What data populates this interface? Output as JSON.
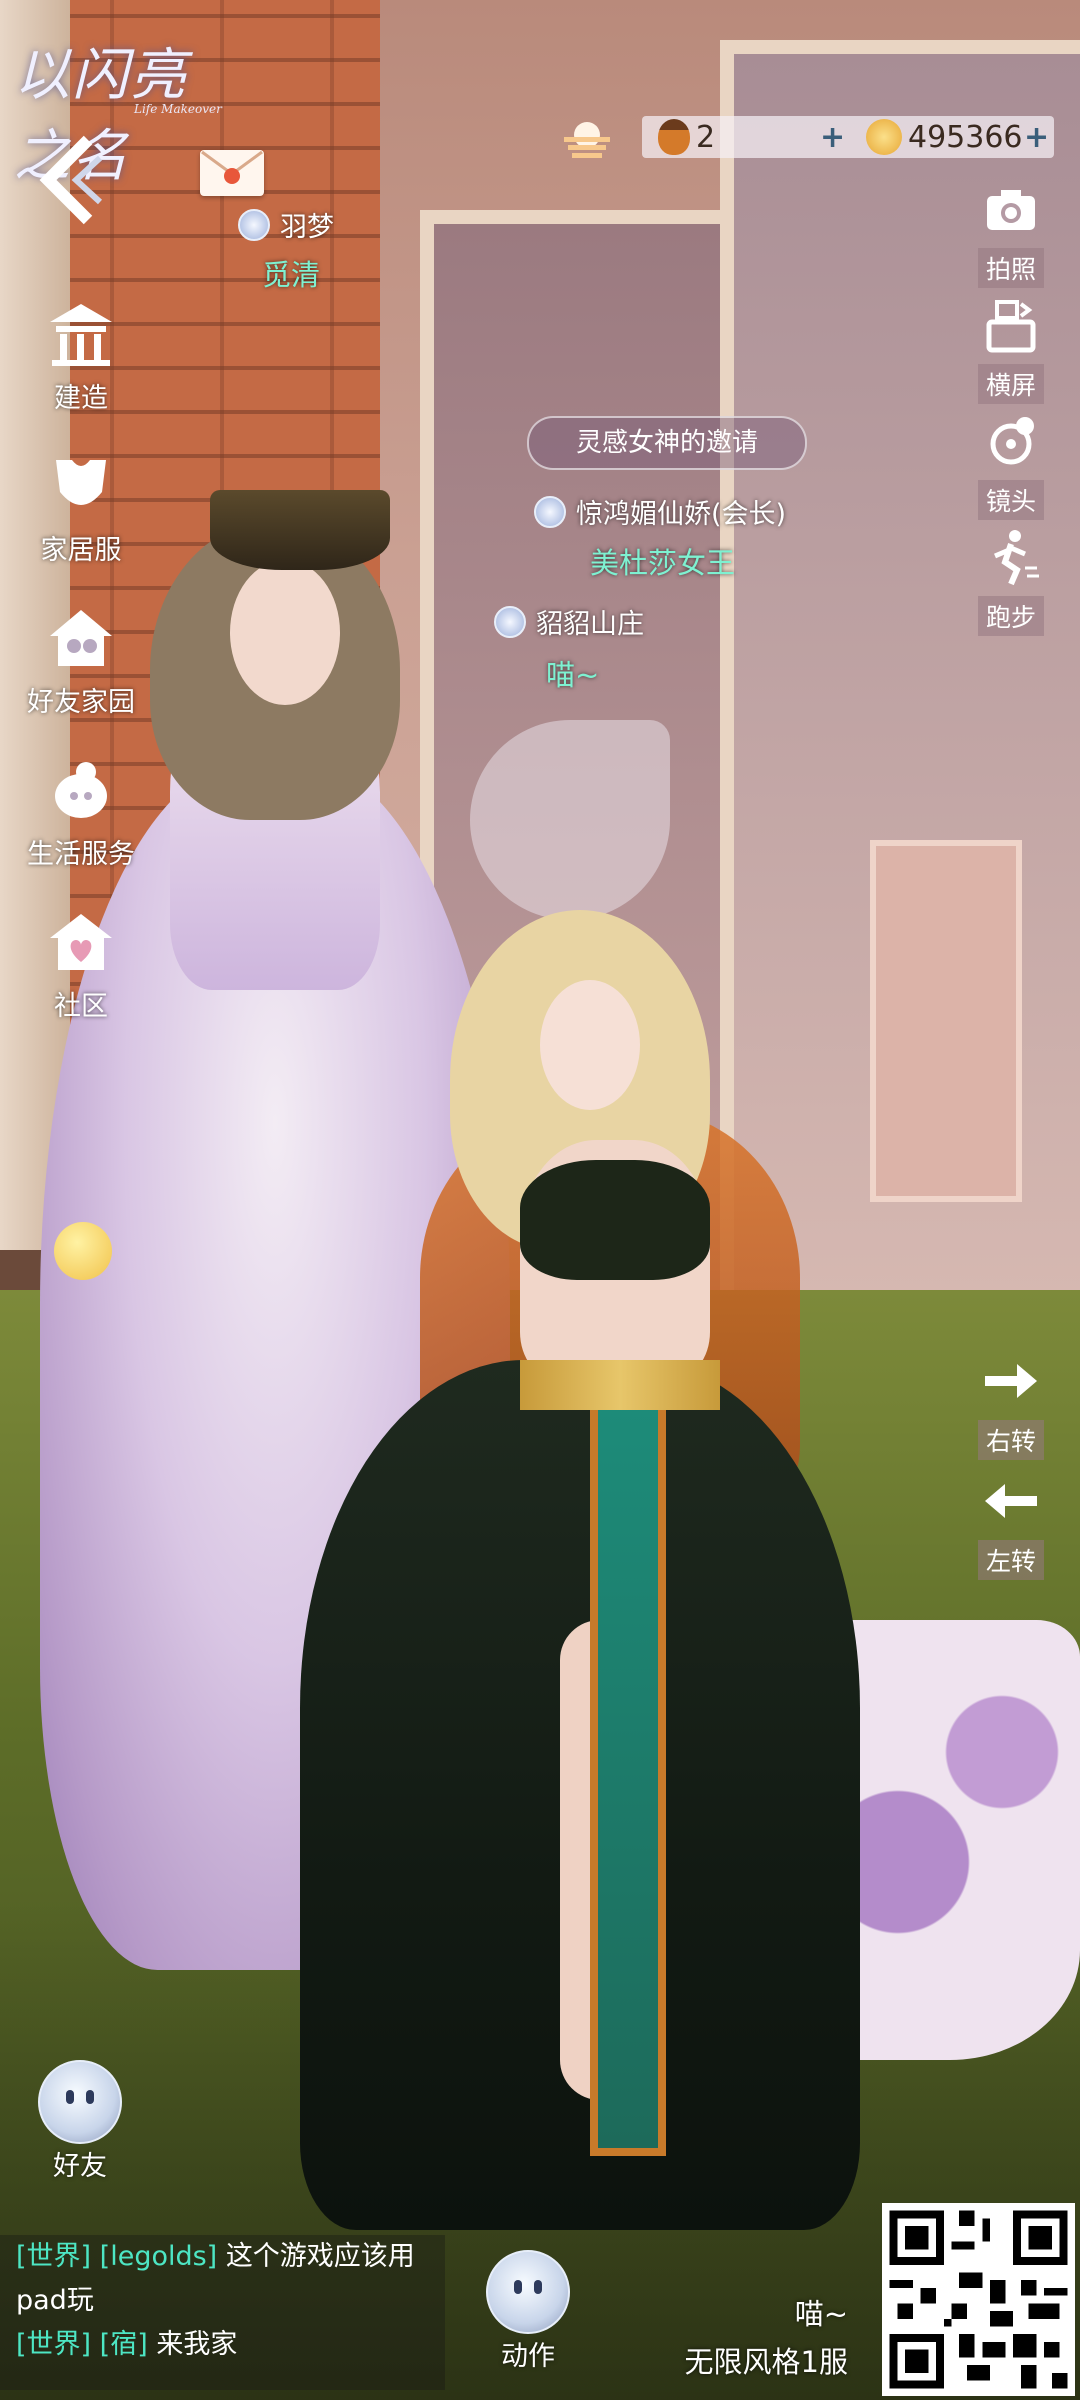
{
  "logo": {
    "title": "以闪亮之名",
    "subtitle": "Life Makeover"
  },
  "topbar": {
    "acorn_count": "2",
    "coin_count": "495366",
    "plus": "+"
  },
  "mail": {
    "icon": "envelope-icon"
  },
  "players": [
    {
      "name": "羽梦",
      "title": "觅清"
    },
    {
      "name": "惊鸿媚仙娇(会长)",
      "title": "美杜莎女王"
    },
    {
      "name": "貂貂山庄",
      "title": "喵~"
    }
  ],
  "invite": {
    "label": "灵感女神的邀请"
  },
  "left_menu": [
    {
      "label": "建造",
      "icon": "build-house-icon"
    },
    {
      "label": "家居服",
      "icon": "home-outfit-icon"
    },
    {
      "label": "好友家园",
      "icon": "friend-home-icon"
    },
    {
      "label": "生活服务",
      "icon": "life-service-icon"
    },
    {
      "label": "社区",
      "icon": "community-icon"
    }
  ],
  "right_menu": [
    {
      "label": "拍照",
      "icon": "camera-icon"
    },
    {
      "label": "横屏",
      "icon": "rotate-screen-icon"
    },
    {
      "label": "镜头",
      "icon": "camera-lens-icon"
    },
    {
      "label": "跑步",
      "icon": "run-icon"
    },
    {
      "label": "右转",
      "icon": "arrow-right-icon"
    },
    {
      "label": "左转",
      "icon": "arrow-left-icon"
    }
  ],
  "bottom": {
    "friend_label": "好友",
    "action_label": "动作"
  },
  "chat": [
    {
      "channel": "[世界]",
      "name": "[legolds]",
      "text": "这个游戏应该用"
    },
    {
      "channel": "",
      "name": "",
      "text": "pad玩"
    },
    {
      "channel": "[世界]",
      "name": "[宿]",
      "text": "来我家"
    }
  ],
  "server": {
    "nickname": "喵~",
    "name": "无限风格1服"
  },
  "colors": {
    "title_green": "#7ef1d1",
    "chat_teal": "#4de6c4"
  }
}
